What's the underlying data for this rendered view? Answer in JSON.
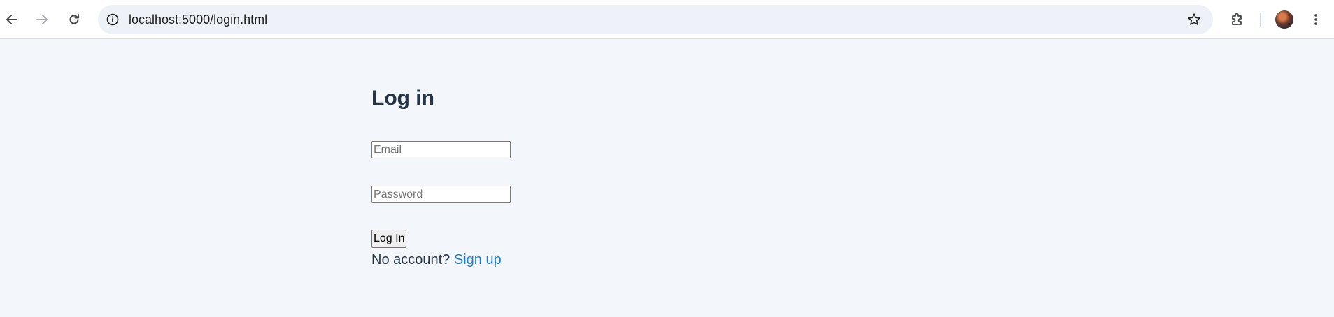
{
  "browser": {
    "url": "localhost:5000/login.html",
    "icons": {
      "back": "back-arrow-icon",
      "forward": "forward-arrow-icon",
      "reload": "reload-icon",
      "site_info": "info-icon",
      "bookmark": "star-icon",
      "extensions": "puzzle-icon",
      "profile": "avatar",
      "menu": "kebab-menu-icon"
    }
  },
  "login": {
    "title": "Log in",
    "email_placeholder": "Email",
    "email_value": "",
    "password_placeholder": "Password",
    "password_value": "",
    "submit_label": "Log In",
    "no_account_text": "No account?",
    "signup_link_text": "Sign up"
  },
  "colors": {
    "page_background": "#f3f6fa",
    "heading_text": "#253547",
    "link": "#1a7fd0",
    "omnibox_background": "#eef1f8"
  }
}
